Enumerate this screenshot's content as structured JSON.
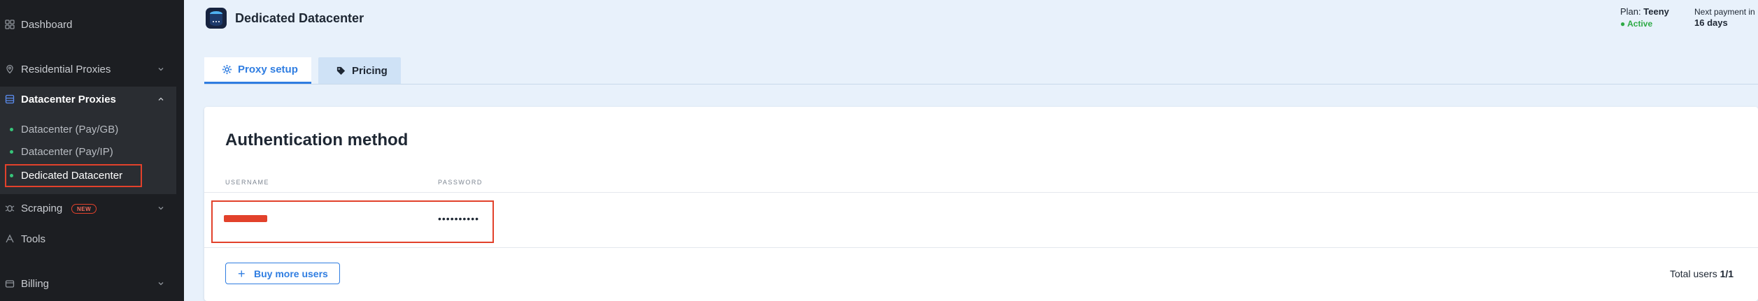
{
  "sidebar": {
    "dashboard": "Dashboard",
    "residential": "Residential Proxies",
    "datacenter": "Datacenter Proxies",
    "sub_items": [
      "Datacenter (Pay/GB)",
      "Datacenter (Pay/IP)",
      "Dedicated Datacenter"
    ],
    "scraping": "Scraping",
    "new_badge": "NEW",
    "tools": "Tools",
    "billing": "Billing"
  },
  "header": {
    "title": "Dedicated Datacenter",
    "plan_label": "Plan:",
    "plan_name": "Teeny",
    "plan_status": "● Active",
    "next_payment_label": "Next payment in",
    "next_payment_value": "16 days"
  },
  "tabs": {
    "proxy_setup": "Proxy setup",
    "pricing": "Pricing"
  },
  "auth": {
    "title": "Authentication method",
    "col_username": "USERNAME",
    "col_password": "PASSWORD",
    "password_masked": "••••••••••",
    "buy_more": "Buy more users",
    "total_label": "Total users",
    "total_value": "1/1"
  },
  "colors": {
    "sidebar_bg": "#1c1e22",
    "accent": "#2f7de1",
    "active_status": "#2eaa45",
    "highlight": "#e2412b"
  }
}
